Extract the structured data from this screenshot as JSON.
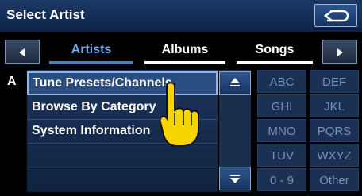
{
  "header": {
    "title": "Select Artist"
  },
  "tabs": [
    {
      "label": "Artists",
      "active": true
    },
    {
      "label": "Albums",
      "active": false
    },
    {
      "label": "Songs",
      "active": false
    }
  ],
  "list": {
    "index_letter": "A",
    "items": [
      "Tune Presets/Channels",
      "Browse By Category",
      "System Information"
    ]
  },
  "keypad": [
    "ABC",
    "DEF",
    "GHI",
    "JKL",
    "MNO",
    "PQRS",
    "TUV",
    "WXYZ",
    "0 - 9",
    "Other"
  ],
  "colors": {
    "accent": "#6fa4e6",
    "panel": "#1d355e",
    "key_text": "#7591b9",
    "hand": "#f5d400"
  },
  "icons": {
    "back": "return-arrow-icon",
    "tab_left": "triangle-left-icon",
    "tab_right": "triangle-right-icon",
    "scroll_up": "scroll-up-icon",
    "scroll_down": "scroll-down-icon",
    "pointer": "pointing-hand-icon"
  }
}
